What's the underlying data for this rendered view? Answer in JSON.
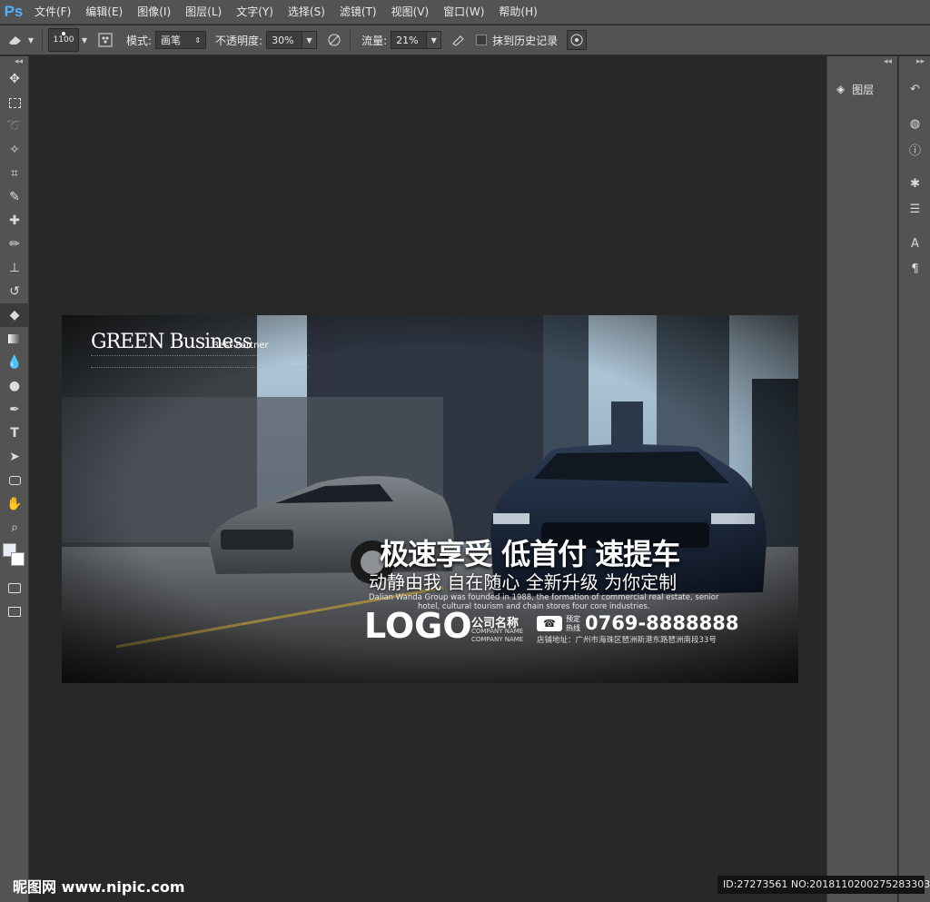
{
  "app": {
    "logo": "Ps"
  },
  "menu": [
    "文件(F)",
    "编辑(E)",
    "图像(I)",
    "图层(L)",
    "文字(Y)",
    "选择(S)",
    "滤镜(T)",
    "视图(V)",
    "窗口(W)",
    "帮助(H)"
  ],
  "options": {
    "brush_size": "1100",
    "mode_label": "模式:",
    "mode_value": "画笔",
    "opacity_label": "不透明度:",
    "opacity_value": "30%",
    "flow_label": "流量:",
    "flow_value": "21%",
    "history_label": "抹到历史记录"
  },
  "panels": {
    "layers_label": "图层"
  },
  "poster": {
    "brand_title": "GREEN Business",
    "brand_sub": "Best Partner",
    "headline": "极速享受 低首付 速提车",
    "subheadline": "动静由我 自在随心 全新升级 为你定制",
    "english_line1": "Dalian Wanda Group was founded in 1988, the formation of commercial real estate, senior",
    "english_line2": "hotel, cultural tourism and chain stores four core industries.",
    "logo": "LOGO",
    "company_name": "公司名称",
    "company_name_en1": "COMPANY NAME",
    "company_name_en2": "COMPANY NAME",
    "hotline_label1": "预定",
    "hotline_label2": "热线",
    "phone": "0769-8888888",
    "address": "店铺地址：广州市海珠区琶洲新港东路琶洲南段33号"
  },
  "footer": {
    "watermark": "昵图网 www.nipic.com",
    "id_text": "ID:27273561 NO:20181102002752833038"
  }
}
